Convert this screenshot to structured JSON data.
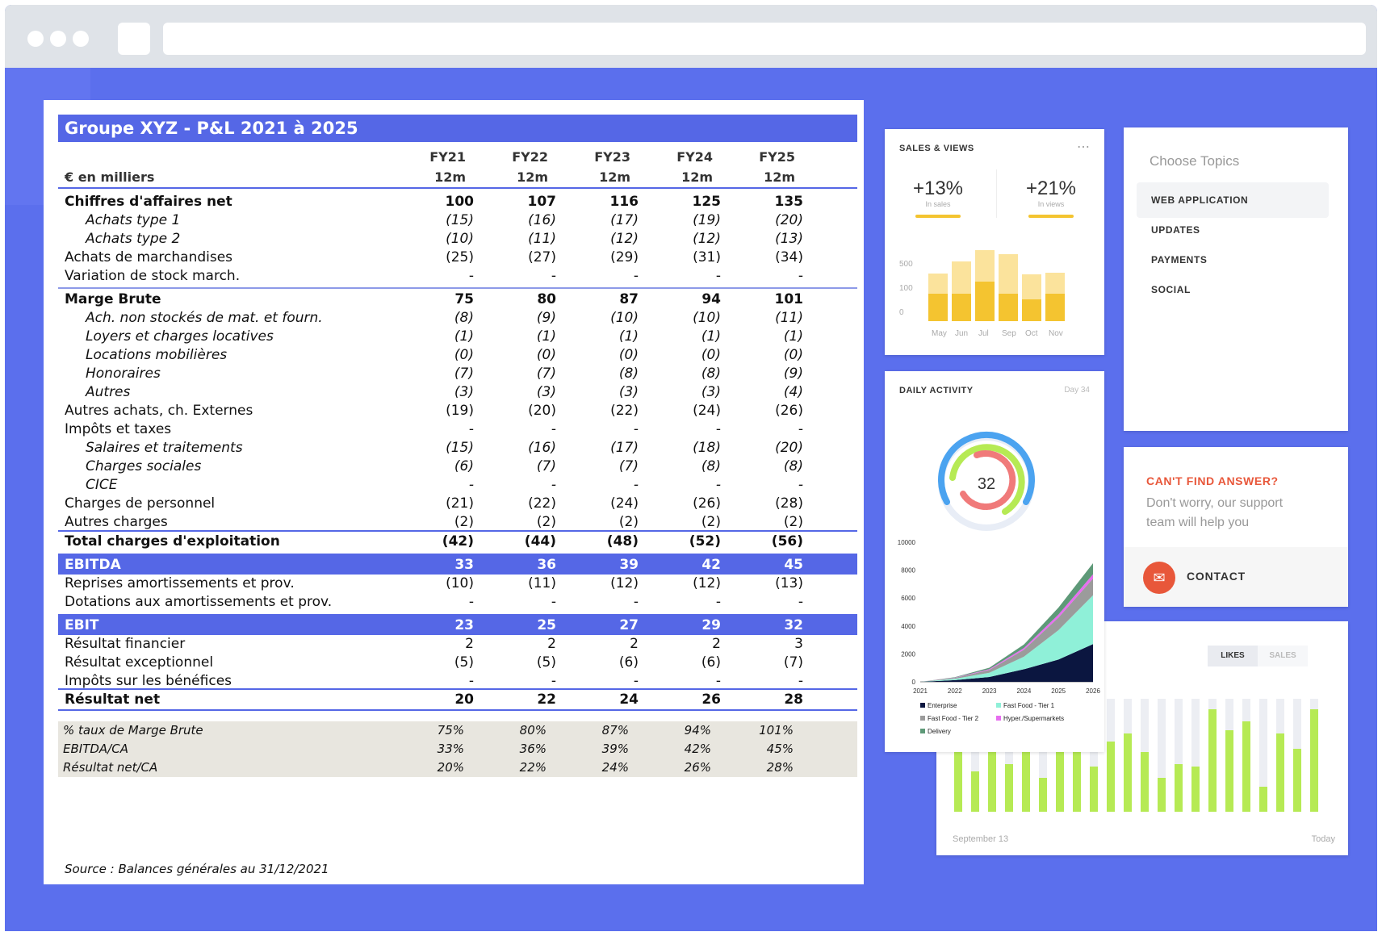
{
  "pnl": {
    "title": "Groupe XYZ - P&L 2021 à 2025",
    "unit_label": "€ en milliers",
    "years": [
      "FY21",
      "FY22",
      "FY23",
      "FY24",
      "FY25"
    ],
    "period": "12m",
    "rows": [
      {
        "label": "Chiffres d'affaires net",
        "values": [
          "100",
          "107",
          "116",
          "125",
          "135"
        ]
      },
      {
        "label": "Achats type 1",
        "values": [
          "(15)",
          "(16)",
          "(17)",
          "(19)",
          "(20)"
        ]
      },
      {
        "label": "Achats type 2",
        "values": [
          "(10)",
          "(11)",
          "(12)",
          "(12)",
          "(13)"
        ]
      },
      {
        "label": "Achats de marchandises",
        "values": [
          "(25)",
          "(27)",
          "(29)",
          "(31)",
          "(34)"
        ]
      },
      {
        "label": "Variation de stock march.",
        "values": [
          "-",
          "-",
          "-",
          "-",
          "-"
        ]
      },
      {
        "label": "Marge Brute",
        "values": [
          "75",
          "80",
          "87",
          "94",
          "101"
        ]
      },
      {
        "label": "Ach. non stockés de mat. et fourn.",
        "values": [
          "(8)",
          "(9)",
          "(10)",
          "(10)",
          "(11)"
        ]
      },
      {
        "label": "Loyers et charges locatives",
        "values": [
          "(1)",
          "(1)",
          "(1)",
          "(1)",
          "(1)"
        ]
      },
      {
        "label": "Locations mobilières",
        "values": [
          "(0)",
          "(0)",
          "(0)",
          "(0)",
          "(0)"
        ]
      },
      {
        "label": "Honoraires",
        "values": [
          "(7)",
          "(7)",
          "(8)",
          "(8)",
          "(9)"
        ]
      },
      {
        "label": "Autres",
        "values": [
          "(3)",
          "(3)",
          "(3)",
          "(3)",
          "(4)"
        ]
      },
      {
        "label": "Autres achats, ch. Externes",
        "values": [
          "(19)",
          "(20)",
          "(22)",
          "(24)",
          "(26)"
        ]
      },
      {
        "label": "Impôts et taxes",
        "values": [
          "-",
          "-",
          "-",
          "-",
          "-"
        ]
      },
      {
        "label": "Salaires et traitements",
        "values": [
          "(15)",
          "(16)",
          "(17)",
          "(18)",
          "(20)"
        ]
      },
      {
        "label": "Charges sociales",
        "values": [
          "(6)",
          "(7)",
          "(7)",
          "(8)",
          "(8)"
        ]
      },
      {
        "label": "CICE",
        "values": [
          "-",
          "-",
          "-",
          "-",
          "-"
        ]
      },
      {
        "label": "Charges de personnel",
        "values": [
          "(21)",
          "(22)",
          "(24)",
          "(26)",
          "(28)"
        ]
      },
      {
        "label": "Autres charges",
        "values": [
          "(2)",
          "(2)",
          "(2)",
          "(2)",
          "(2)"
        ]
      },
      {
        "label": "Total charges d'exploitation",
        "values": [
          "(42)",
          "(44)",
          "(48)",
          "(52)",
          "(56)"
        ]
      },
      {
        "label": "EBITDA",
        "values": [
          "33",
          "36",
          "39",
          "42",
          "45"
        ]
      },
      {
        "label": "Reprises amortissements et prov.",
        "values": [
          "(10)",
          "(11)",
          "(12)",
          "(12)",
          "(13)"
        ]
      },
      {
        "label": "Dotations aux amortissements et prov.",
        "values": [
          "-",
          "-",
          "-",
          "-",
          "-"
        ]
      },
      {
        "label": "EBIT",
        "values": [
          "23",
          "25",
          "27",
          "29",
          "32"
        ]
      },
      {
        "label": "Résultat financier",
        "values": [
          "2",
          "2",
          "2",
          "2",
          "3"
        ]
      },
      {
        "label": "Résultat exceptionnel",
        "values": [
          "(5)",
          "(5)",
          "(6)",
          "(6)",
          "(7)"
        ]
      },
      {
        "label": "Impôts sur les bénéfices",
        "values": [
          "-",
          "-",
          "-",
          "-",
          "-"
        ]
      },
      {
        "label": "Résultat net",
        "values": [
          "20",
          "22",
          "24",
          "26",
          "28"
        ]
      },
      {
        "label": "% taux de Marge Brute",
        "values": [
          "75%",
          "80%",
          "87%",
          "94%",
          "101%"
        ]
      },
      {
        "label": "EBITDA/CA",
        "values": [
          "33%",
          "36%",
          "39%",
          "42%",
          "45%"
        ]
      },
      {
        "label": "Résultat net/CA",
        "values": [
          "20%",
          "22%",
          "24%",
          "26%",
          "28%"
        ]
      }
    ],
    "source": "Source : Balances générales au 31/12/2021"
  },
  "sales_views": {
    "title": "SALES & VIEWS",
    "menu_icon": "more-dots-icon",
    "stats": [
      {
        "value": "+13%",
        "caption": "In sales"
      },
      {
        "value": "+21%",
        "caption": "In views"
      }
    ],
    "y_ticks": [
      "500",
      "100",
      "0"
    ],
    "months": [
      "May",
      "Jun",
      "Jul",
      "Sep",
      "Oct",
      "Nov"
    ],
    "bars_total": [
      0.67,
      0.84,
      1.0,
      0.94,
      0.66,
      0.68
    ],
    "bars_base": [
      0.39,
      0.39,
      0.56,
      0.39,
      0.31,
      0.39
    ],
    "accent": "#f4c430"
  },
  "topics": {
    "title": "Choose Topics",
    "items": [
      "WEB APPLICATION",
      "UPDATES",
      "PAYMENTS",
      "SOCIAL"
    ],
    "selected": 0
  },
  "help": {
    "title": "CAN'T FIND ANSWER?",
    "text": "Don't worry, our support team will help you",
    "contact_label": "CONTACT",
    "contact_icon": "mail-icon",
    "accent": "#e8573a"
  },
  "daily_activity": {
    "title": "DAILY ACTIVITY",
    "day_label": "Day 34",
    "center_value": "32"
  },
  "area_chart": {
    "chart_data": {
      "type": "area",
      "x": [
        "2021",
        "2022",
        "2023",
        "2024",
        "2025",
        "2026"
      ],
      "y_ticks": [
        "10000",
        "8000",
        "6000",
        "4000",
        "2000",
        "0"
      ],
      "ylim": [
        0,
        10000
      ],
      "series": [
        {
          "name": "Enterprise",
          "color": "#0b1640",
          "values": [
            0,
            120,
            350,
            900,
            1600,
            2700
          ]
        },
        {
          "name": "Fast Food - Tier 1",
          "color": "#8ff0d8",
          "values": [
            0,
            100,
            300,
            900,
            2100,
            3500
          ]
        },
        {
          "name": "Fast Food - Tier 2",
          "color": "#9b9b9b",
          "values": [
            0,
            60,
            200,
            500,
            900,
            1200
          ]
        },
        {
          "name": "Hyper./Supermarkets",
          "color": "#e76ef0",
          "values": [
            0,
            20,
            60,
            120,
            220,
            300
          ]
        },
        {
          "name": "Delivery",
          "color": "#5e9978",
          "values": [
            0,
            30,
            100,
            250,
            500,
            800
          ]
        }
      ]
    }
  },
  "likes_sales": {
    "tabs": [
      "LIKES",
      "SALES"
    ],
    "selected": 0,
    "left_label": "September 13",
    "right_label": "Today",
    "bars": [
      0.58,
      0.36,
      0.59,
      0.42,
      0.57,
      0.3,
      0.75,
      0.6,
      0.4,
      0.62,
      0.69,
      0.53,
      0.3,
      0.42,
      0.4,
      0.91,
      0.72,
      0.8,
      0.22,
      0.69,
      0.56,
      0.91
    ],
    "bar_color": "#b6ea54",
    "track_color": "#eceef3"
  }
}
